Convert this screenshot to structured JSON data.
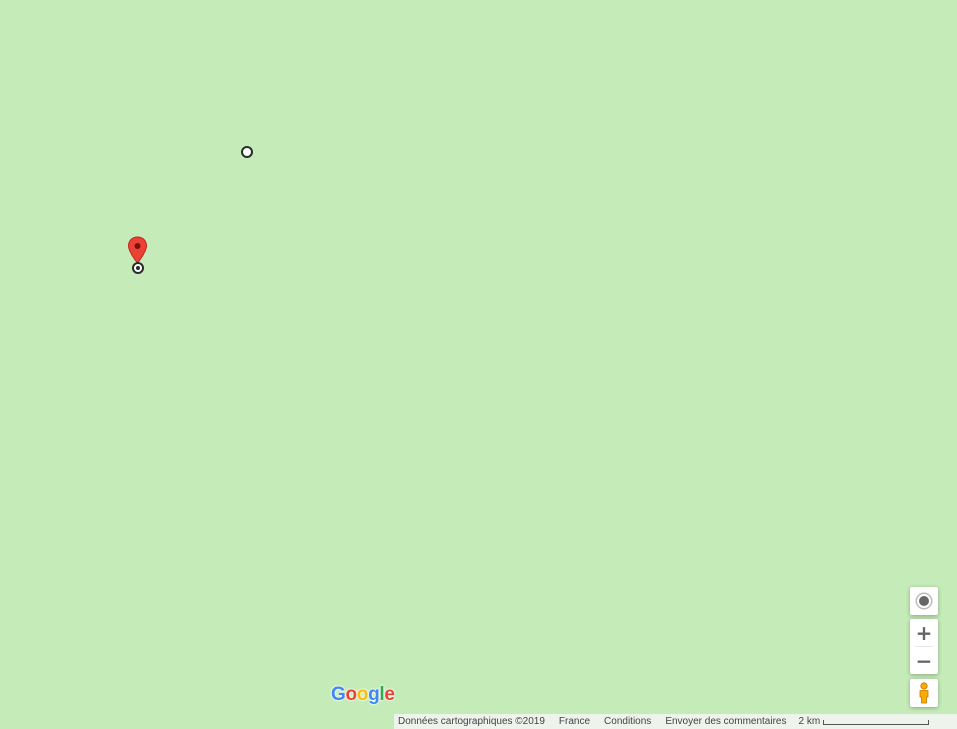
{
  "map": {
    "background_color": "#c5ecb8",
    "markers": [
      {
        "kind": "waypoint",
        "icon": "hollow-circle-icon"
      },
      {
        "kind": "destination-pin",
        "icon": "map-pin-icon",
        "color": "#ea4335"
      },
      {
        "kind": "origin",
        "icon": "target-circle-icon"
      }
    ]
  },
  "branding": {
    "logo_letters": [
      "G",
      "o",
      "o",
      "g",
      "l",
      "e"
    ],
    "logo_colors": [
      "#4285f4",
      "#ea4335",
      "#fbbc05",
      "#4285f4",
      "#34a853",
      "#ea4335"
    ]
  },
  "footer": {
    "map_data": "Données cartographiques ©2019",
    "region": "France",
    "terms": "Conditions",
    "feedback": "Envoyer des commentaires",
    "scale_label": "2 km"
  },
  "controls": {
    "locate_icon": "my-location-icon",
    "zoom_in_label": "+",
    "zoom_out_label": "−",
    "street_view_icon": "pegman-icon"
  }
}
